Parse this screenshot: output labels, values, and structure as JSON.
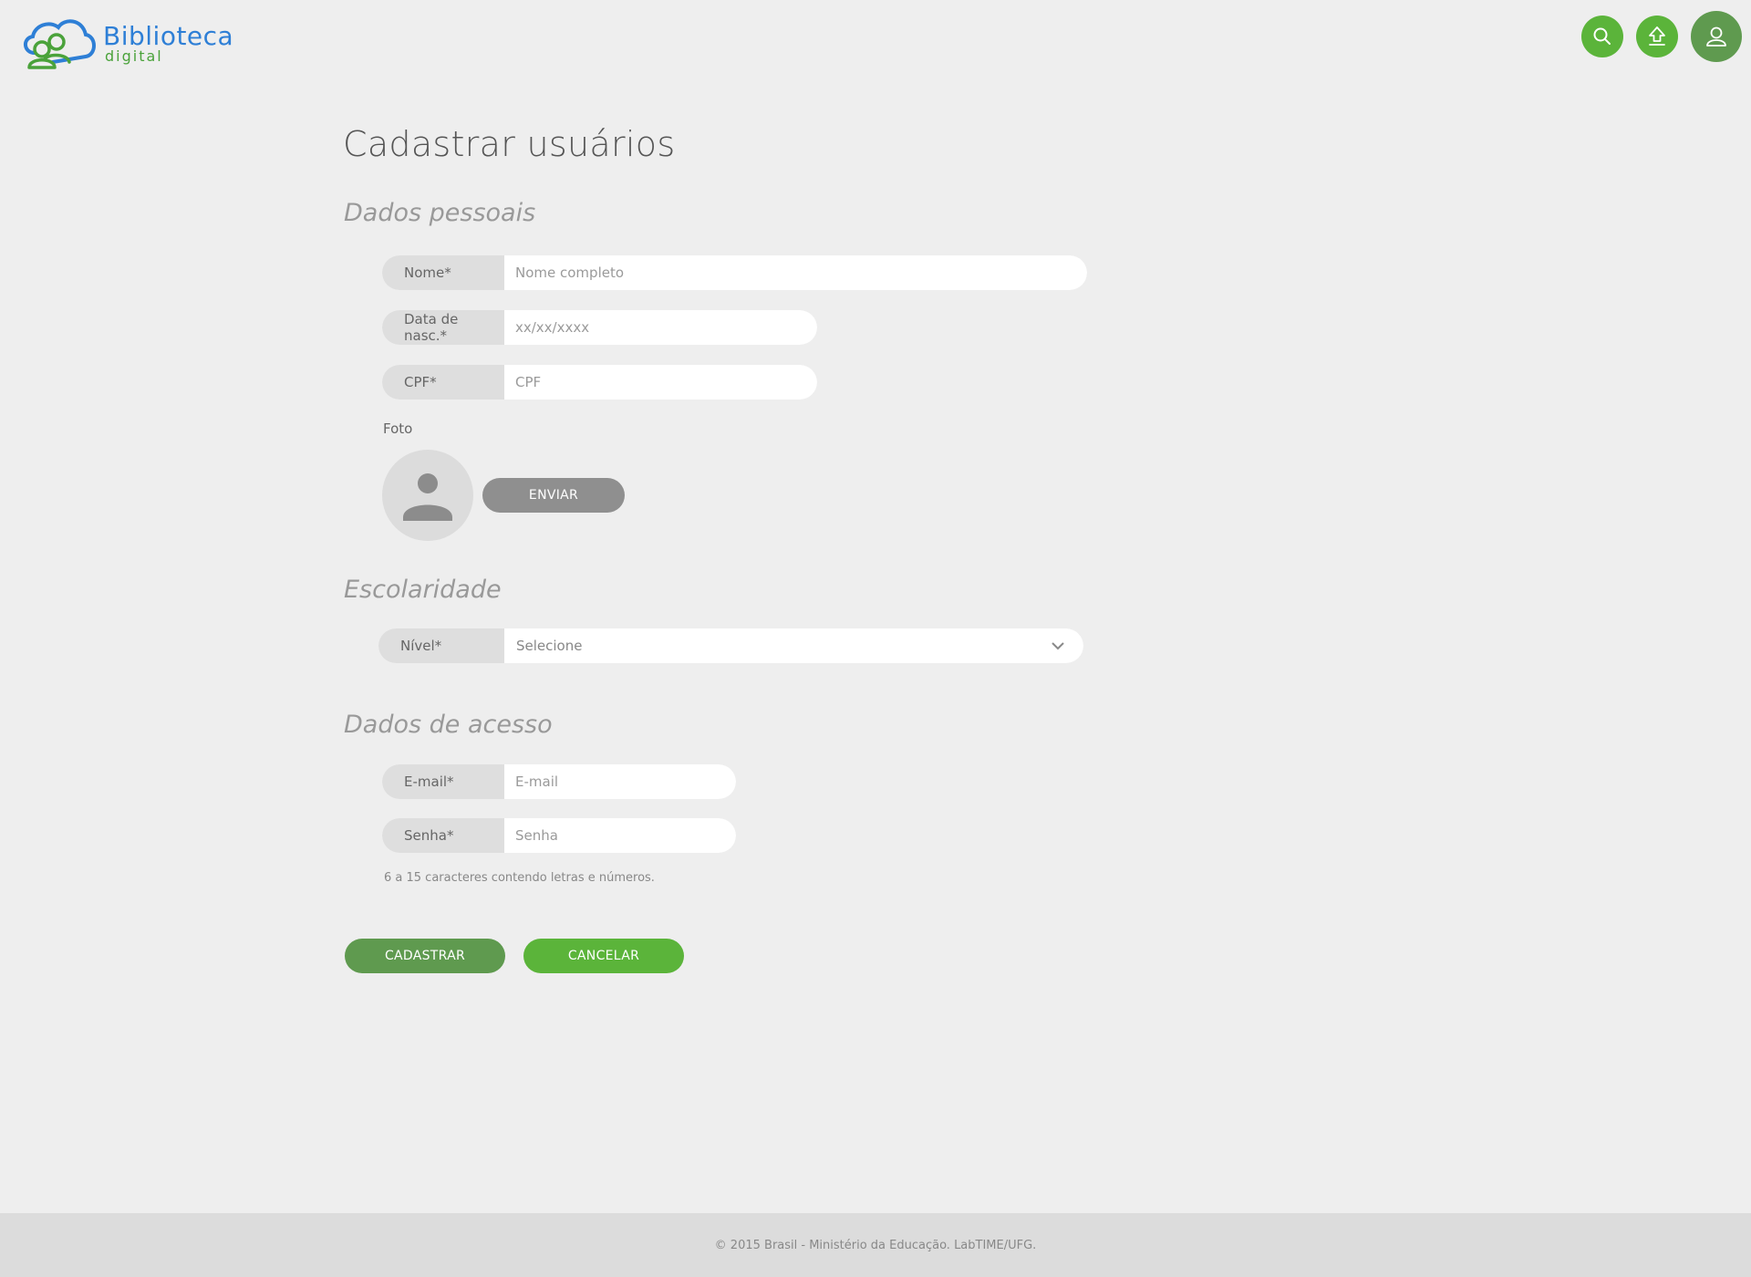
{
  "header": {
    "logo_title": "Biblioteca",
    "logo_subtitle": "digital",
    "icons": [
      "search-icon",
      "upload-icon",
      "user-icon"
    ],
    "colors": {
      "green": "#5bb43a",
      "dark_green": "#5f9a4f",
      "blue": "#2e7fd6"
    }
  },
  "page": {
    "title": "Cadastrar usuários"
  },
  "sections": {
    "personal": "Dados pessoais",
    "schooling": "Escolaridade",
    "access": "Dados de acesso"
  },
  "fields": {
    "name": {
      "label": "Nome*",
      "placeholder": "Nome completo"
    },
    "birth": {
      "label": "Data de nasc.*",
      "placeholder": "xx/xx/xxxx"
    },
    "cpf": {
      "label": "CPF*",
      "placeholder": "CPF"
    },
    "photo": {
      "label": "Foto",
      "button": "ENVIAR"
    },
    "level": {
      "label": "Nível*",
      "selected": "Selecione"
    },
    "email": {
      "label": "E-mail*",
      "placeholder": "E-mail"
    },
    "password": {
      "label": "Senha*",
      "placeholder": "Senha"
    }
  },
  "password_hint": "6 a 15 caracteres contendo letras e números.",
  "actions": {
    "submit": "CADASTRAR",
    "cancel": "CANCELAR"
  },
  "footer": {
    "text": "© 2015 Brasil - Ministério da Educação. LabTIME/UFG."
  }
}
